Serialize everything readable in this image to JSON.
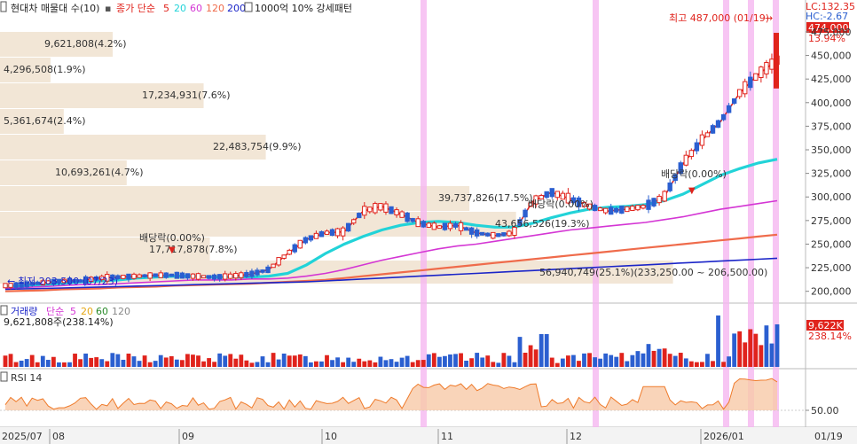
{
  "header": {
    "stock_name": "현대차 매물대 수(10)",
    "indicator_prefix": "종가 단순",
    "ma": [
      {
        "label": "5",
        "color": "#e0231c"
      },
      {
        "label": "20",
        "color": "#22d3d8"
      },
      {
        "label": "60",
        "color": "#d436d4"
      },
      {
        "label": "120",
        "color": "#ef6b4b"
      },
      {
        "label": "200",
        "color": "#1b25c8"
      }
    ],
    "pattern_label": "1000억 10% 강세패턴"
  },
  "top_right": {
    "lc": "LC:132.35",
    "hc": "HC:-2.67"
  },
  "price_badge": {
    "price": "474,000",
    "pct": "13.94%"
  },
  "high_marker": {
    "text": "최고 487,000 (01/19)",
    "arrow": "→"
  },
  "low_marker": {
    "text": "최저 203,500 (07/23)",
    "arrow": "←"
  },
  "dividend_labels": [
    "배당락(0.00%)",
    "배당락(0.00%)",
    "배당락(0.00%)"
  ],
  "volume_profile": [
    {
      "label": "9,621,808(4.2%)",
      "bar": 0.145
    },
    {
      "label": "4,296,508(1.9%)",
      "bar": 0.065
    },
    {
      "label": "17,234,931(7.6%)",
      "bar": 0.262
    },
    {
      "label": "5,361,674(2.4%)",
      "bar": 0.082
    },
    {
      "label": "22,483,754(9.9%)",
      "bar": 0.342
    },
    {
      "label": "10,693,261(4.7%)",
      "bar": 0.163
    },
    {
      "label": "39,737,826(17.5%)",
      "bar": 0.604
    },
    {
      "label": "43,656,526(19.3%)",
      "bar": 0.664
    },
    {
      "label": "17,717,878(7.8%)",
      "bar": 0.27
    },
    {
      "label": "56,940,749(25.1%)(233,250.00 ~ 206,500.00)",
      "bar": 0.866
    }
  ],
  "price_axis": [
    "475,000",
    "450,000",
    "425,000",
    "400,000",
    "375,000",
    "350,000",
    "325,000",
    "300,000",
    "275,000",
    "250,000",
    "225,000",
    "200,000"
  ],
  "volume_panel": {
    "title_parts": [
      {
        "text": "거래량",
        "color": "#1b25c8"
      },
      {
        "text": "단순",
        "color": "#d436d4"
      },
      {
        "text": "5",
        "color": "#d436d4"
      },
      {
        "text": "20",
        "color": "#e6a817"
      },
      {
        "text": "60",
        "color": "#2a8a2a"
      },
      {
        "text": "120",
        "color": "#888888"
      }
    ],
    "subtitle": "9,621,808주(238.14%)",
    "badge_value": "9,622K",
    "badge_pct": "238.14%"
  },
  "rsi_panel": {
    "title": "RSI 14",
    "axis_label": "50.00"
  },
  "date_axis": [
    "2025/07",
    "08",
    "09",
    "10",
    "11",
    "12",
    "2026/01",
    "01/19"
  ],
  "colors": {
    "up": "#e0231c",
    "down": "#2b5fd0",
    "highlight": "#f5b6f0",
    "profile": "#f2e6d6"
  },
  "chart_data": {
    "type": "candlestick",
    "title": "현대차",
    "y_unit": "KRW",
    "ylim": [
      195000,
      490000
    ],
    "x_start": "2025/07",
    "x_end": "2026/01/19",
    "last_close": 474000,
    "high": 487000,
    "low": 203500,
    "series": [
      {
        "name": "5",
        "values": [
          206000,
          207000,
          209000,
          211000,
          211000,
          214000,
          215000,
          216000,
          217000,
          217000,
          216000,
          215000,
          216000,
          218000,
          223000,
          240000,
          255000,
          262000,
          263000,
          285000,
          290000,
          282000,
          272000,
          268000,
          270000,
          262000,
          259000,
          262000,
          295000,
          305000,
          298000,
          290000,
          285000,
          287000,
          290000,
          300000,
          335000,
          360000,
          380000,
          410000,
          430000,
          445000
        ]
      },
      {
        "name": "20",
        "values": [
          205000,
          206000,
          207000,
          208000,
          210000,
          211000,
          212000,
          214000,
          215000,
          216000,
          216000,
          215000,
          215000,
          215000,
          216000,
          219000,
          228000,
          240000,
          250000,
          258000,
          265000,
          270000,
          273000,
          274000,
          273000,
          270000,
          268000,
          268000,
          272000,
          278000,
          283000,
          287000,
          289000,
          290000,
          292000,
          296000,
          303000,
          313000,
          323000,
          330000,
          336000,
          340000
        ]
      },
      {
        "name": "60",
        "values": [
          203000,
          204000,
          205000,
          206000,
          207000,
          207000,
          208000,
          209000,
          210000,
          211000,
          212000,
          212000,
          212000,
          213000,
          213000,
          214000,
          216000,
          219000,
          223000,
          228000,
          233000,
          237000,
          241000,
          245000,
          248000,
          250000,
          253000,
          256000,
          259000,
          262000,
          265000,
          267000,
          269000,
          271000,
          273000,
          276000,
          279000,
          283000,
          287000,
          290000,
          293000,
          296000
        ]
      },
      {
        "name": "120",
        "values": [
          200000,
          200500,
          201000,
          202000,
          202500,
          203000,
          204000,
          204500,
          205000,
          206000,
          206500,
          207000,
          207500,
          208000,
          209000,
          210000,
          211000,
          212000,
          214000,
          216000,
          218000,
          220000,
          222000,
          224000,
          226000,
          228000,
          230000,
          232000,
          234000,
          236000,
          238000,
          240000,
          242000,
          244000,
          246000,
          248000,
          250000,
          252000,
          254000,
          256000,
          258000,
          260000
        ]
      },
      {
        "name": "200",
        "values": [
          202000,
          202500,
          203000,
          203500,
          204000,
          204500,
          205000,
          205500,
          206000,
          206500,
          207000,
          207500,
          208000,
          208500,
          209000,
          209500,
          210000,
          211000,
          212000,
          213000,
          214000,
          215000,
          216000,
          217000,
          218000,
          219000,
          220000,
          221000,
          222000,
          223000,
          224000,
          225000,
          226000,
          227000,
          228000,
          229000,
          230000,
          231000,
          232000,
          233000,
          234000,
          235000
        ]
      }
    ]
  }
}
